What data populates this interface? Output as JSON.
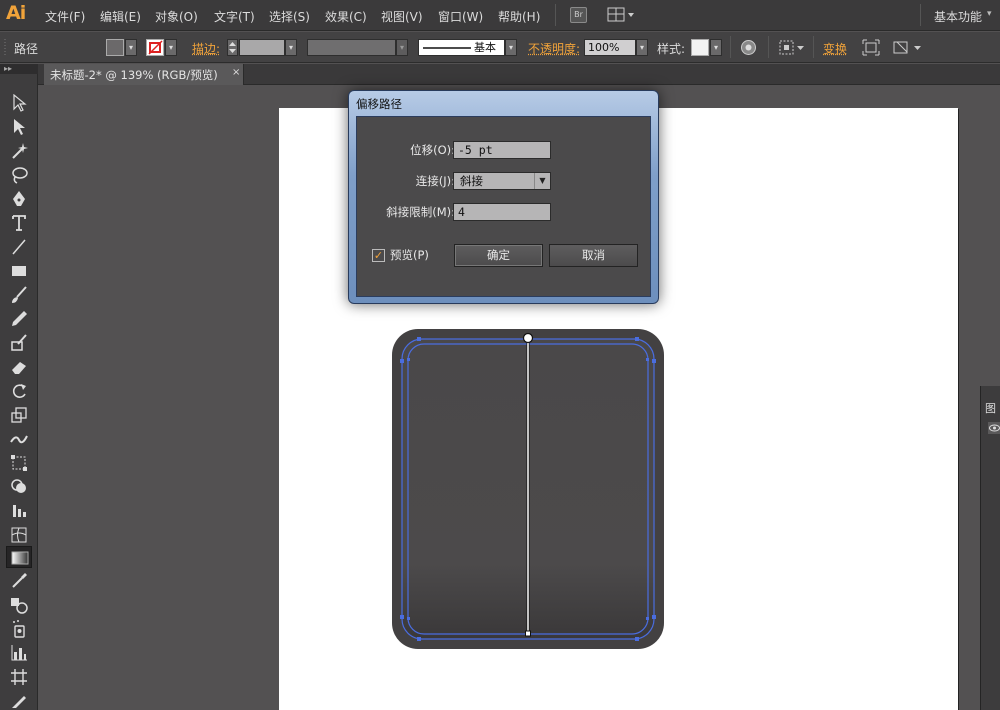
{
  "app": {
    "logo": "Ai"
  },
  "menu": {
    "items": [
      "文件(F)",
      "编辑(E)",
      "对象(O)",
      "文字(T)",
      "选择(S)",
      "效果(C)",
      "视图(V)",
      "窗口(W)",
      "帮助(H)"
    ],
    "bridge_button": "Br",
    "workspace": "基本功能",
    "workspace_caret": "▾"
  },
  "controlbar": {
    "selection_label": "路径",
    "stroke_label": "描边:",
    "stroke_style": "基本",
    "opacity_label": "不透明度:",
    "opacity_value": "100%",
    "style_label": "样式:",
    "transform_label": "变换"
  },
  "document": {
    "tab_title": "未标题-2* @ 139% (RGB/预览)",
    "tab_close": "×",
    "tools_collapse": "▸▸"
  },
  "dialog": {
    "title": "偏移路径",
    "offset_label": "位移(O):",
    "offset_value": "-5 pt",
    "joins_label": "连接(J):",
    "joins_value": "斜接",
    "miter_label": "斜接限制(M):",
    "miter_value": "4",
    "preview_label": "预览(P)",
    "preview_checked": true,
    "ok_label": "确定",
    "cancel_label": "取消"
  },
  "right_panel": {
    "tab_label": "图"
  },
  "colors": {
    "accent": "#f1a33a",
    "selection": "#4a6de0",
    "shape_fill": "#4d4b4c",
    "artboard": "#ffffff"
  }
}
